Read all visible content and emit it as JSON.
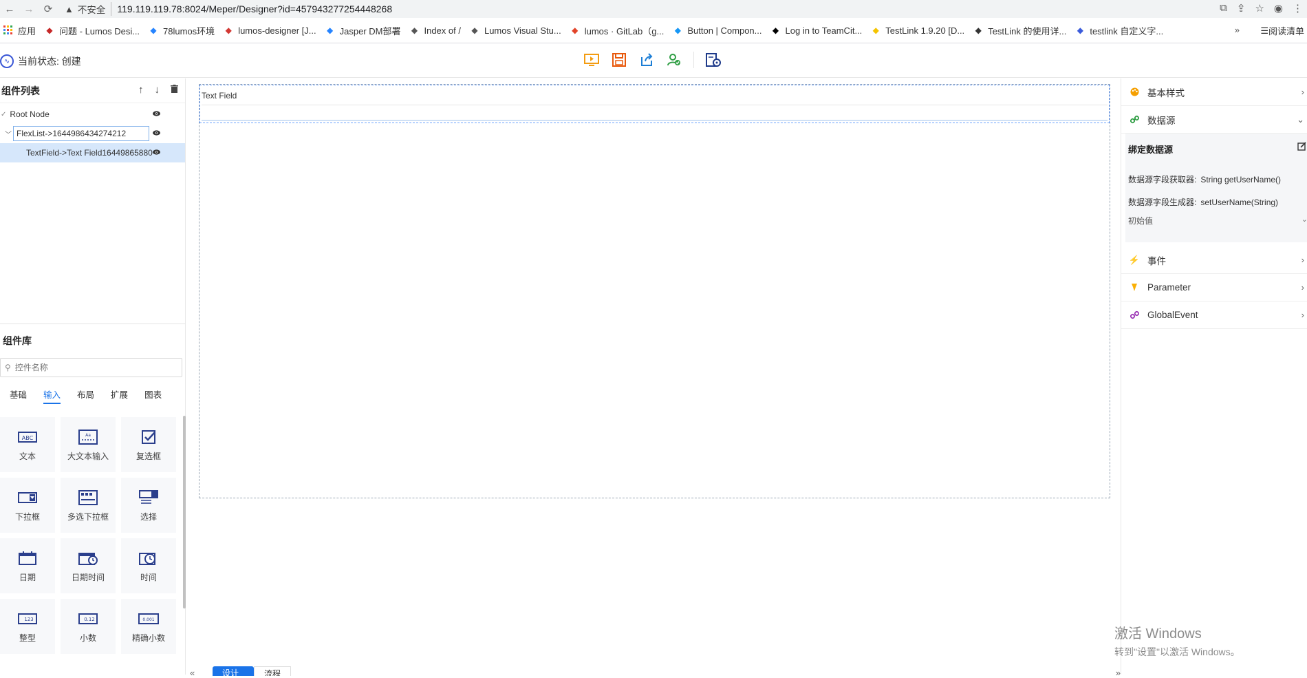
{
  "browser": {
    "insecure": "不安全",
    "url": "119.119.119.78:8024/Meper/Designer?id=457943277254448268"
  },
  "bookmarks": {
    "apps": "应用",
    "items": [
      {
        "label": "问题 - Lumos Desi...",
        "icon": "lumos-icon",
        "color": "#c62828"
      },
      {
        "label": "78lumos环境",
        "icon": "jira-icon",
        "color": "#2684ff"
      },
      {
        "label": "lumos-designer [J...",
        "icon": "jenkins-icon",
        "color": "#d33833"
      },
      {
        "label": "Jasper DM部署",
        "icon": "jira-icon",
        "color": "#2684ff"
      },
      {
        "label": "Index of /",
        "icon": "globe-icon",
        "color": "#555555"
      },
      {
        "label": "Lumos Visual Stu...",
        "icon": "globe-icon",
        "color": "#555555"
      },
      {
        "label": "lumos · GitLab（g...",
        "icon": "gitlab-icon",
        "color": "#e24329"
      },
      {
        "label": "Button | Compon...",
        "icon": "vuetify-icon",
        "color": "#1697f6"
      },
      {
        "label": "Log in to TeamCit...",
        "icon": "teamcity-icon",
        "color": "#000000"
      },
      {
        "label": "TestLink 1.9.20 [D...",
        "icon": "testlink-icon",
        "color": "#f5c400"
      },
      {
        "label": "TestLink 的使用详...",
        "icon": "testlink-icon",
        "color": "#333333"
      },
      {
        "label": "testlink 自定义字...",
        "icon": "ps-icon",
        "color": "#3b5bdb"
      }
    ],
    "more": "»",
    "reading_list": "阅读清单"
  },
  "toolbar": {
    "status": "当前状态: 创建"
  },
  "component_tree": {
    "title": "组件列表",
    "nodes": [
      {
        "label": "Root Node"
      },
      {
        "label": "FlexList->1644986434274212"
      },
      {
        "label": "TextField->Text Field16449865880"
      }
    ]
  },
  "library": {
    "title": "组件库",
    "search_placeholder": "控件名称",
    "tabs": [
      "基础",
      "输入",
      "布局",
      "扩展",
      "图表"
    ],
    "active_tab": "输入",
    "items": [
      {
        "label": "文本",
        "icon": "text-input-icon"
      },
      {
        "label": "大文本输入",
        "icon": "textarea-icon"
      },
      {
        "label": "复选框",
        "icon": "checkbox-icon"
      },
      {
        "label": "下拉框",
        "icon": "dropdown-icon"
      },
      {
        "label": "多选下拉框",
        "icon": "multi-dropdown-icon"
      },
      {
        "label": "选择",
        "icon": "select-icon"
      },
      {
        "label": "日期",
        "icon": "date-icon"
      },
      {
        "label": "日期时间",
        "icon": "datetime-icon"
      },
      {
        "label": "时间",
        "icon": "time-icon"
      },
      {
        "label": "整型",
        "icon": "integer-icon"
      },
      {
        "label": "小数",
        "icon": "decimal-icon"
      },
      {
        "label": "精确小数",
        "icon": "precise-decimal-icon"
      }
    ]
  },
  "canvas": {
    "field_label": "Text Field"
  },
  "bottom_tabs": {
    "design": "设计",
    "flow": "流程"
  },
  "properties": {
    "basic_style": "基本样式",
    "datasource": "数据源",
    "bind_title": "绑定数据源",
    "getter_label": "数据源字段获取器:",
    "getter_value": "String getUserName()",
    "setter_label": "数据源字段生成器:",
    "setter_value": "setUserName(String)",
    "initial_value": "初始值",
    "events": "事件",
    "parameter": "Parameter",
    "global_event": "GlobalEvent"
  },
  "watermark": {
    "line1": "激活 Windows",
    "line2": "转到\"设置\"以激活 Windows。"
  },
  "colors": {
    "accent": "#1a73e8",
    "selected_row": "#d6e7fb",
    "tool_orange": "#f39c12",
    "tool_red": "#e8590c",
    "tool_blue": "#1c7ed6",
    "tool_green": "#2f9e44",
    "tool_navy": "#1e3a8a"
  }
}
